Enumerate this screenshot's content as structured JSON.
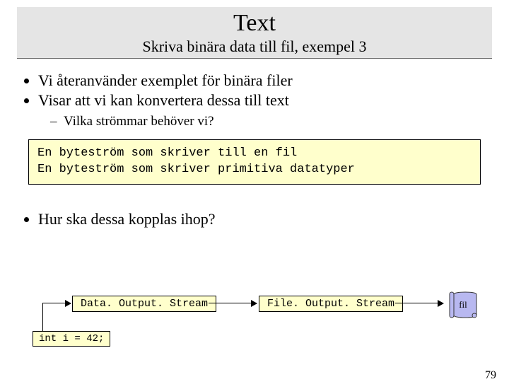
{
  "title": "Text",
  "subtitle": "Skriva binära data till fil, exempel 3",
  "bullets": {
    "b0": "Vi återanvänder exemplet för binära filer",
    "b1": "Visar att vi kan konvertera dessa till text",
    "sub0": "Vilka strömmar behöver vi?"
  },
  "codebox": "En byteström som skriver till en fil\nEn byteström som skriver primitiva datatyper",
  "q2": "Hur ska dessa kopplas ihop?",
  "flow": {
    "dos": "Data. Output. Stream",
    "fos": "File. Output. Stream",
    "intline": "int i = 42;",
    "file_label": "fil"
  },
  "page_number": "79"
}
